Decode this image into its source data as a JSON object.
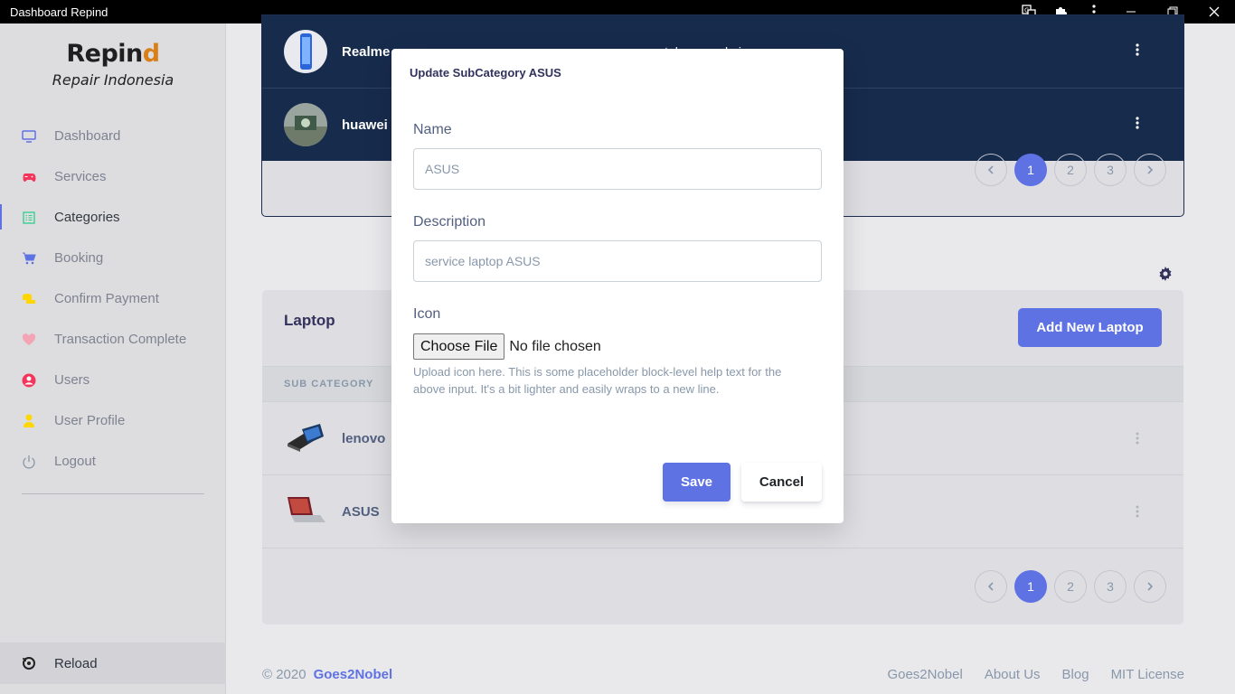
{
  "window": {
    "title": "Dashboard Repind"
  },
  "brand": {
    "logo_main": "Repin",
    "logo_accent": "d",
    "subtitle": "Repair Indonesia"
  },
  "sidebar": {
    "items": [
      {
        "label": "Dashboard",
        "icon": "monitor-icon",
        "color": "#5e72e4"
      },
      {
        "label": "Services",
        "icon": "gamepad-icon",
        "color": "#f5365c"
      },
      {
        "label": "Categories",
        "icon": "list-icon",
        "color": "#2dce89",
        "active": true
      },
      {
        "label": "Booking",
        "icon": "cart-icon",
        "color": "#5e72e4"
      },
      {
        "label": "Confirm Payment",
        "icon": "coins-icon",
        "color": "#ffd600"
      },
      {
        "label": "Transaction Complete",
        "icon": "heart-icon",
        "color": "#f3a4b5"
      },
      {
        "label": "Users",
        "icon": "user-circle-icon",
        "color": "#fb6340"
      },
      {
        "label": "User Profile",
        "icon": "user-icon",
        "color": "#ffd600"
      },
      {
        "label": "Logout",
        "icon": "power-icon",
        "color": "#8898aa"
      }
    ],
    "reload_label": "Reload"
  },
  "top_table": {
    "rows": [
      {
        "name": "Realme",
        "description": "smartphone realmi"
      },
      {
        "name": "huawei",
        "description": ""
      }
    ],
    "pages": [
      "1",
      "2",
      "3"
    ]
  },
  "laptop": {
    "title": "Laptop",
    "add_label": "Add New Laptop",
    "column_header": "SUB CATEGORY",
    "rows": [
      {
        "name": "lenovo"
      },
      {
        "name": "ASUS"
      }
    ],
    "pages": [
      "1",
      "2",
      "3"
    ]
  },
  "footer": {
    "copyright": "© 2020",
    "brand_link": "Goes2Nobel",
    "links": [
      "Goes2Nobel",
      "About Us",
      "Blog",
      "MIT License"
    ]
  },
  "modal": {
    "title": "Update SubCategory ASUS",
    "name_label": "Name",
    "name_placeholder": "ASUS",
    "description_label": "Description",
    "description_placeholder": "service laptop ASUS",
    "icon_label": "Icon",
    "choose_file_label": "Choose File",
    "no_file_text": "No file chosen",
    "help_text": "Upload icon here. This is some placeholder block-level help text for the above input. It's a bit lighter and easily wraps to a new line.",
    "save_label": "Save",
    "cancel_label": "Cancel"
  }
}
